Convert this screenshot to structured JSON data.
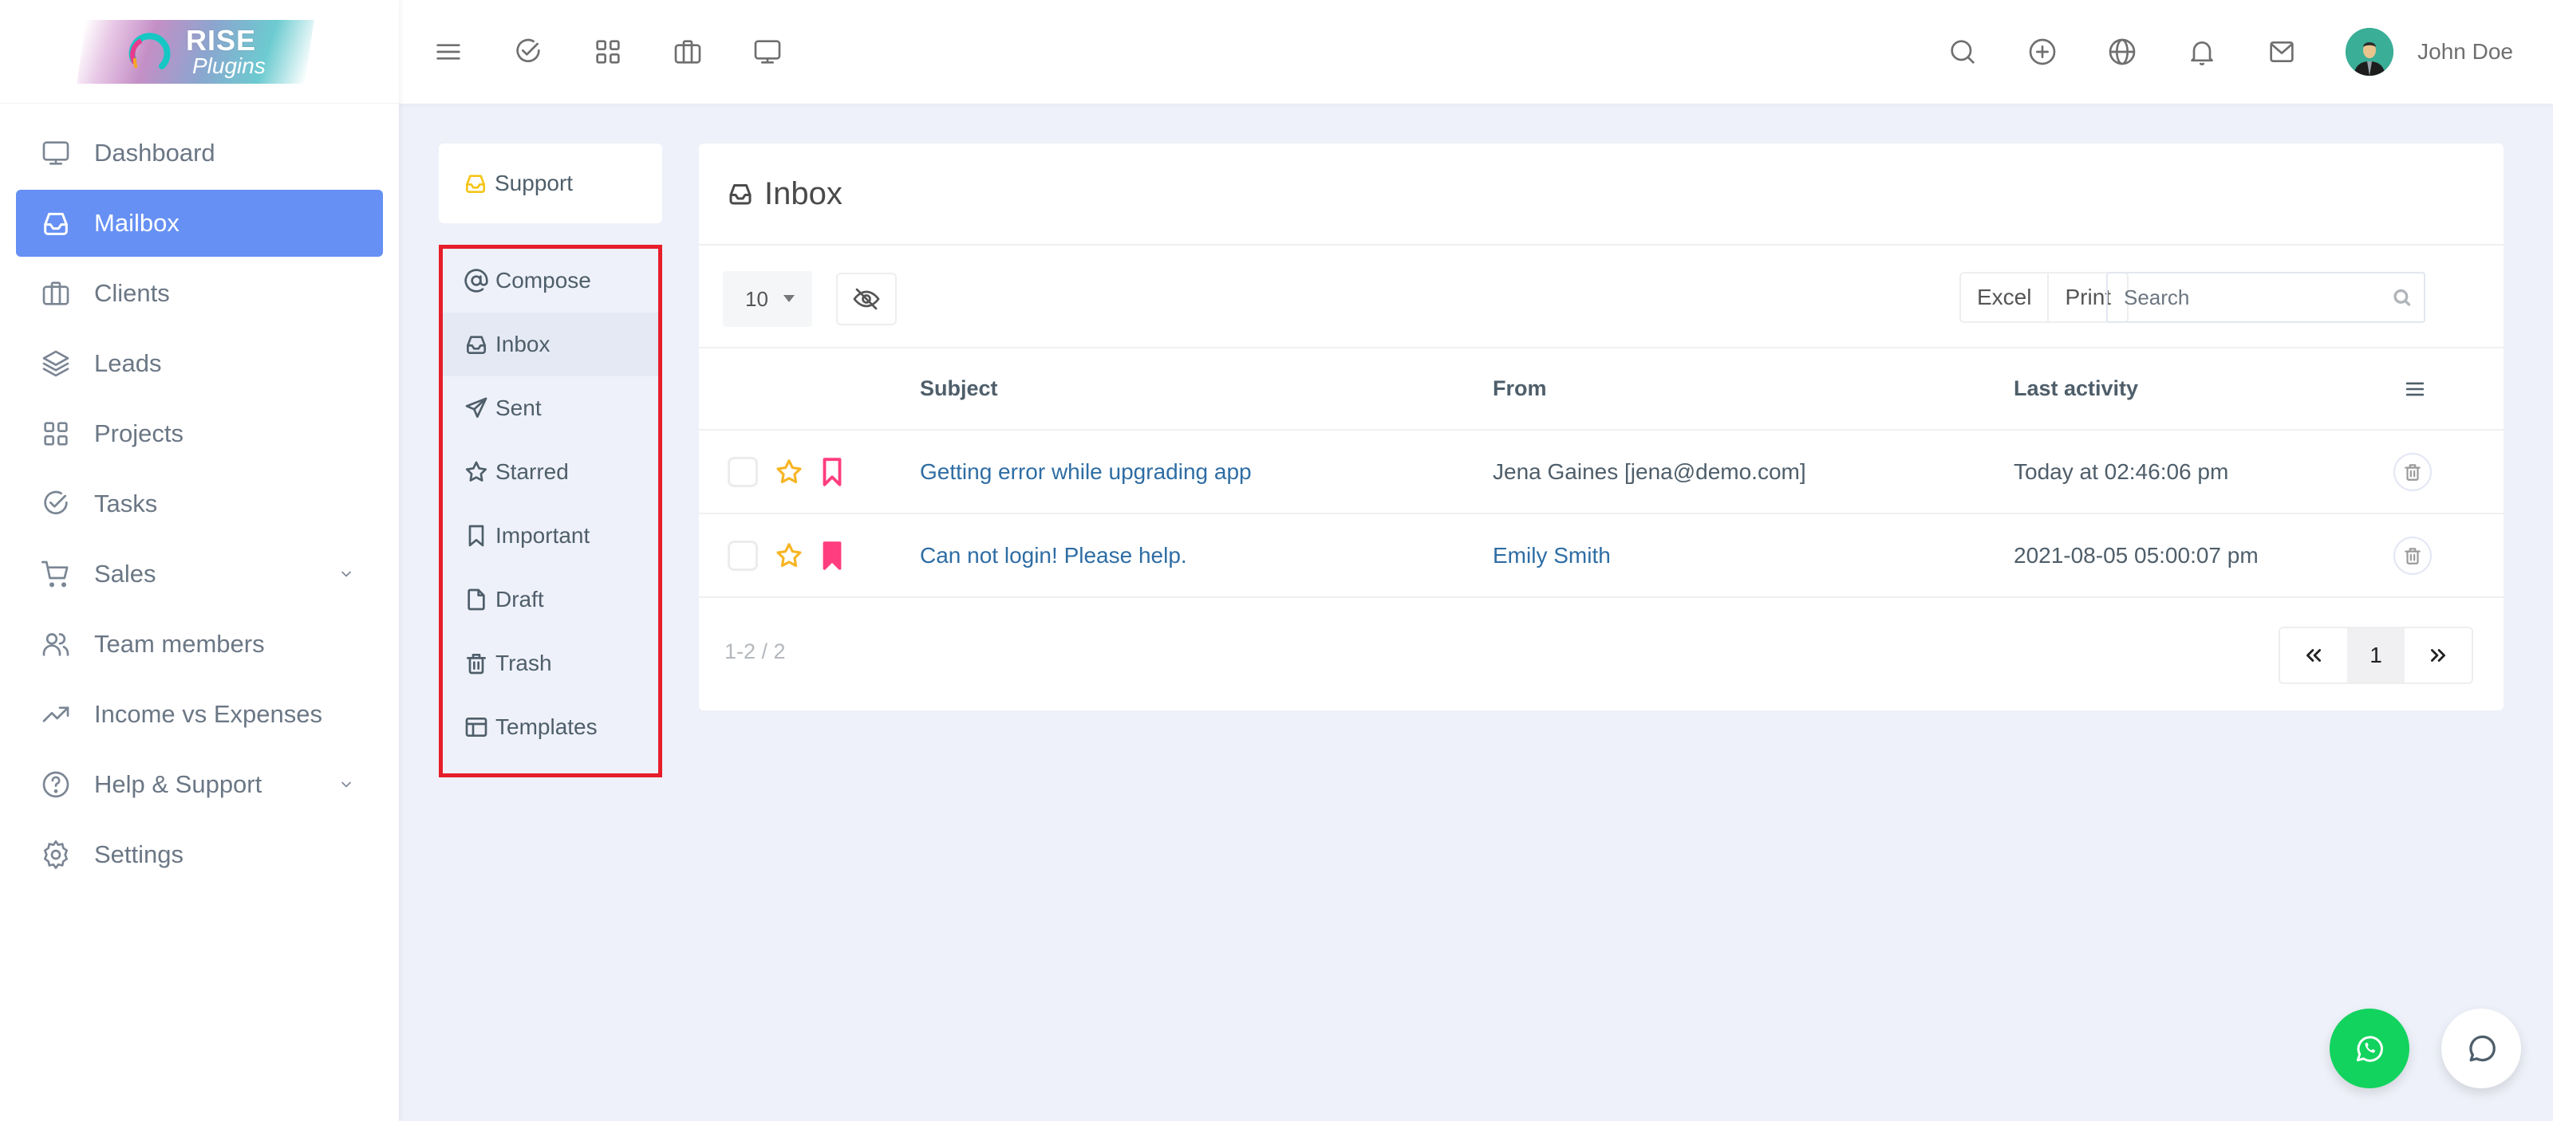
{
  "logo": {
    "line1": "RISE",
    "line2": "Plugins"
  },
  "sidebar": {
    "items": [
      {
        "label": "Dashboard",
        "icon": "monitor-icon",
        "active": false
      },
      {
        "label": "Mailbox",
        "icon": "inbox-icon",
        "active": true
      },
      {
        "label": "Clients",
        "icon": "briefcase-icon",
        "active": false
      },
      {
        "label": "Leads",
        "icon": "layers-icon",
        "active": false
      },
      {
        "label": "Projects",
        "icon": "grid-icon",
        "active": false
      },
      {
        "label": "Tasks",
        "icon": "check-circle-icon",
        "active": false
      },
      {
        "label": "Sales",
        "icon": "cart-icon",
        "active": false,
        "expandable": true
      },
      {
        "label": "Team members",
        "icon": "users-icon",
        "active": false
      },
      {
        "label": "Income vs Expenses",
        "icon": "trending-up-icon",
        "active": false
      },
      {
        "label": "Help & Support",
        "icon": "help-circle-icon",
        "active": false,
        "expandable": true
      },
      {
        "label": "Settings",
        "icon": "gear-icon",
        "active": false
      }
    ]
  },
  "topbar": {
    "left_icons": [
      "menu-icon",
      "check-circle-icon",
      "grid-icon",
      "briefcase-icon",
      "monitor-icon"
    ],
    "right_icons": [
      "search-icon",
      "plus-circle-icon",
      "globe-icon",
      "bell-icon",
      "mail-icon"
    ],
    "user_name": "John Doe"
  },
  "mailbox": {
    "account": "Support",
    "folders": [
      {
        "label": "Compose",
        "icon": "at-icon",
        "active": false
      },
      {
        "label": "Inbox",
        "icon": "inbox-icon",
        "active": true
      },
      {
        "label": "Sent",
        "icon": "send-icon",
        "active": false
      },
      {
        "label": "Starred",
        "icon": "star-icon",
        "active": false
      },
      {
        "label": "Important",
        "icon": "bookmark-icon",
        "active": false
      },
      {
        "label": "Draft",
        "icon": "file-icon",
        "active": false
      },
      {
        "label": "Trash",
        "icon": "trash-icon",
        "active": false
      },
      {
        "label": "Templates",
        "icon": "layout-icon",
        "active": false
      }
    ]
  },
  "inbox": {
    "title": "Inbox",
    "page_size": "10",
    "export_buttons": [
      "Excel",
      "Print"
    ],
    "search_placeholder": "Search",
    "columns": [
      "",
      "Subject",
      "From",
      "Last activity"
    ],
    "rows": [
      {
        "starred": false,
        "important": false,
        "subject": "Getting error while upgrading app",
        "from": "Jena Gaines [jena@demo.com]",
        "from_is_link": false,
        "last_activity": "Today at 02:46:06 pm"
      },
      {
        "starred": false,
        "important": true,
        "subject": "Can not login! Please help.",
        "from": "Emily Smith",
        "from_is_link": true,
        "last_activity": "2021-08-05 05:00:07 pm"
      }
    ],
    "count_text": "1-2 / 2",
    "current_page": "1"
  },
  "colors": {
    "accent": "#6690f4",
    "star": "#f7b524",
    "important": "#ff3d7f",
    "link": "#2e6da4",
    "highlight_box": "#e61e2a",
    "whatsapp": "#12d35e"
  }
}
